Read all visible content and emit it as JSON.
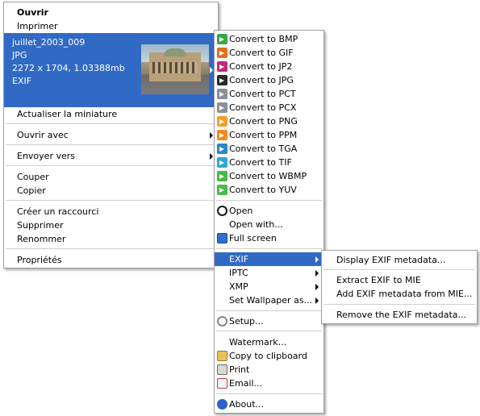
{
  "context_menu": {
    "items": {
      "open": "Ouvrir",
      "print": "Imprimer",
      "refresh_thumbnail": "Actualiser la miniature",
      "open_with": "Ouvrir avec",
      "send_to": "Envoyer vers",
      "cut": "Couper",
      "copy": "Copier",
      "create_shortcut": "Créer un raccourci",
      "delete": "Supprimer",
      "rename": "Renommer",
      "properties": "Propriétés"
    },
    "preview": {
      "filename": "juillet_2003_009",
      "format": "JPG",
      "dimensions": "2272 x 1704, 1.03388mb",
      "exif": "EXIF"
    }
  },
  "plugin_menu": {
    "convert": [
      {
        "label": "Convert to BMP",
        "color": "#3aa64a"
      },
      {
        "label": "Convert to GIF",
        "color": "#e07020"
      },
      {
        "label": "Convert to JP2",
        "color": "#c02a7a"
      },
      {
        "label": "Convert to JPG",
        "color": "#2a2a2a"
      },
      {
        "label": "Convert to PCT",
        "color": "#8a9098"
      },
      {
        "label": "Convert to PCX",
        "color": "#8a9098"
      },
      {
        "label": "Convert to PNG",
        "color": "#f0a030"
      },
      {
        "label": "Convert to PPM",
        "color": "#f08a20"
      },
      {
        "label": "Convert to TGA",
        "color": "#2e86c8"
      },
      {
        "label": "Convert to TIF",
        "color": "#30a8d8"
      },
      {
        "label": "Convert to WBMP",
        "color": "#4ab84a"
      },
      {
        "label": "Convert to YUV",
        "color": "#4ab84a"
      }
    ],
    "open": "Open",
    "open_with": "Open with...",
    "full_screen": "Full screen",
    "exif": "EXIF",
    "iptc": "IPTC",
    "xmp": "XMP",
    "set_wallpaper": "Set Wallpaper as...",
    "setup": "Setup...",
    "watermark": "Watermark...",
    "copy_to_clipboard": "Copy to clipboard",
    "print": "Print",
    "email": "Email...",
    "about": "About..."
  },
  "exif_submenu": {
    "display": "Display EXIF metadata...",
    "extract": "Extract EXIF to MIE",
    "add": "Add EXIF metadata from MIE...",
    "remove": "Remove the EXIF metadata..."
  },
  "colors": {
    "highlight": "#316ac5",
    "highlight_text": "#ffffff"
  }
}
